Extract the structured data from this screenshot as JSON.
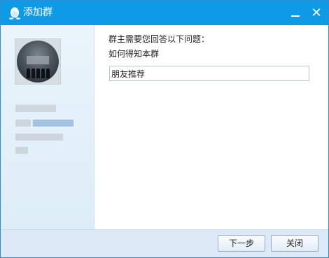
{
  "window": {
    "title": "添加群",
    "app_icon": "qq-penguin-icon",
    "minimize_icon": "minimize-icon",
    "close_icon": "close-icon",
    "accent_color": "#0f9ae5"
  },
  "sidebar": {
    "avatar_icon": "group-avatar"
  },
  "form": {
    "question_label": "群主需要您回答以下问题：",
    "question_text": "如何得知本群",
    "answer_value": "朋友推荐"
  },
  "footer": {
    "next_label": "下一步",
    "close_label": "关闭"
  }
}
